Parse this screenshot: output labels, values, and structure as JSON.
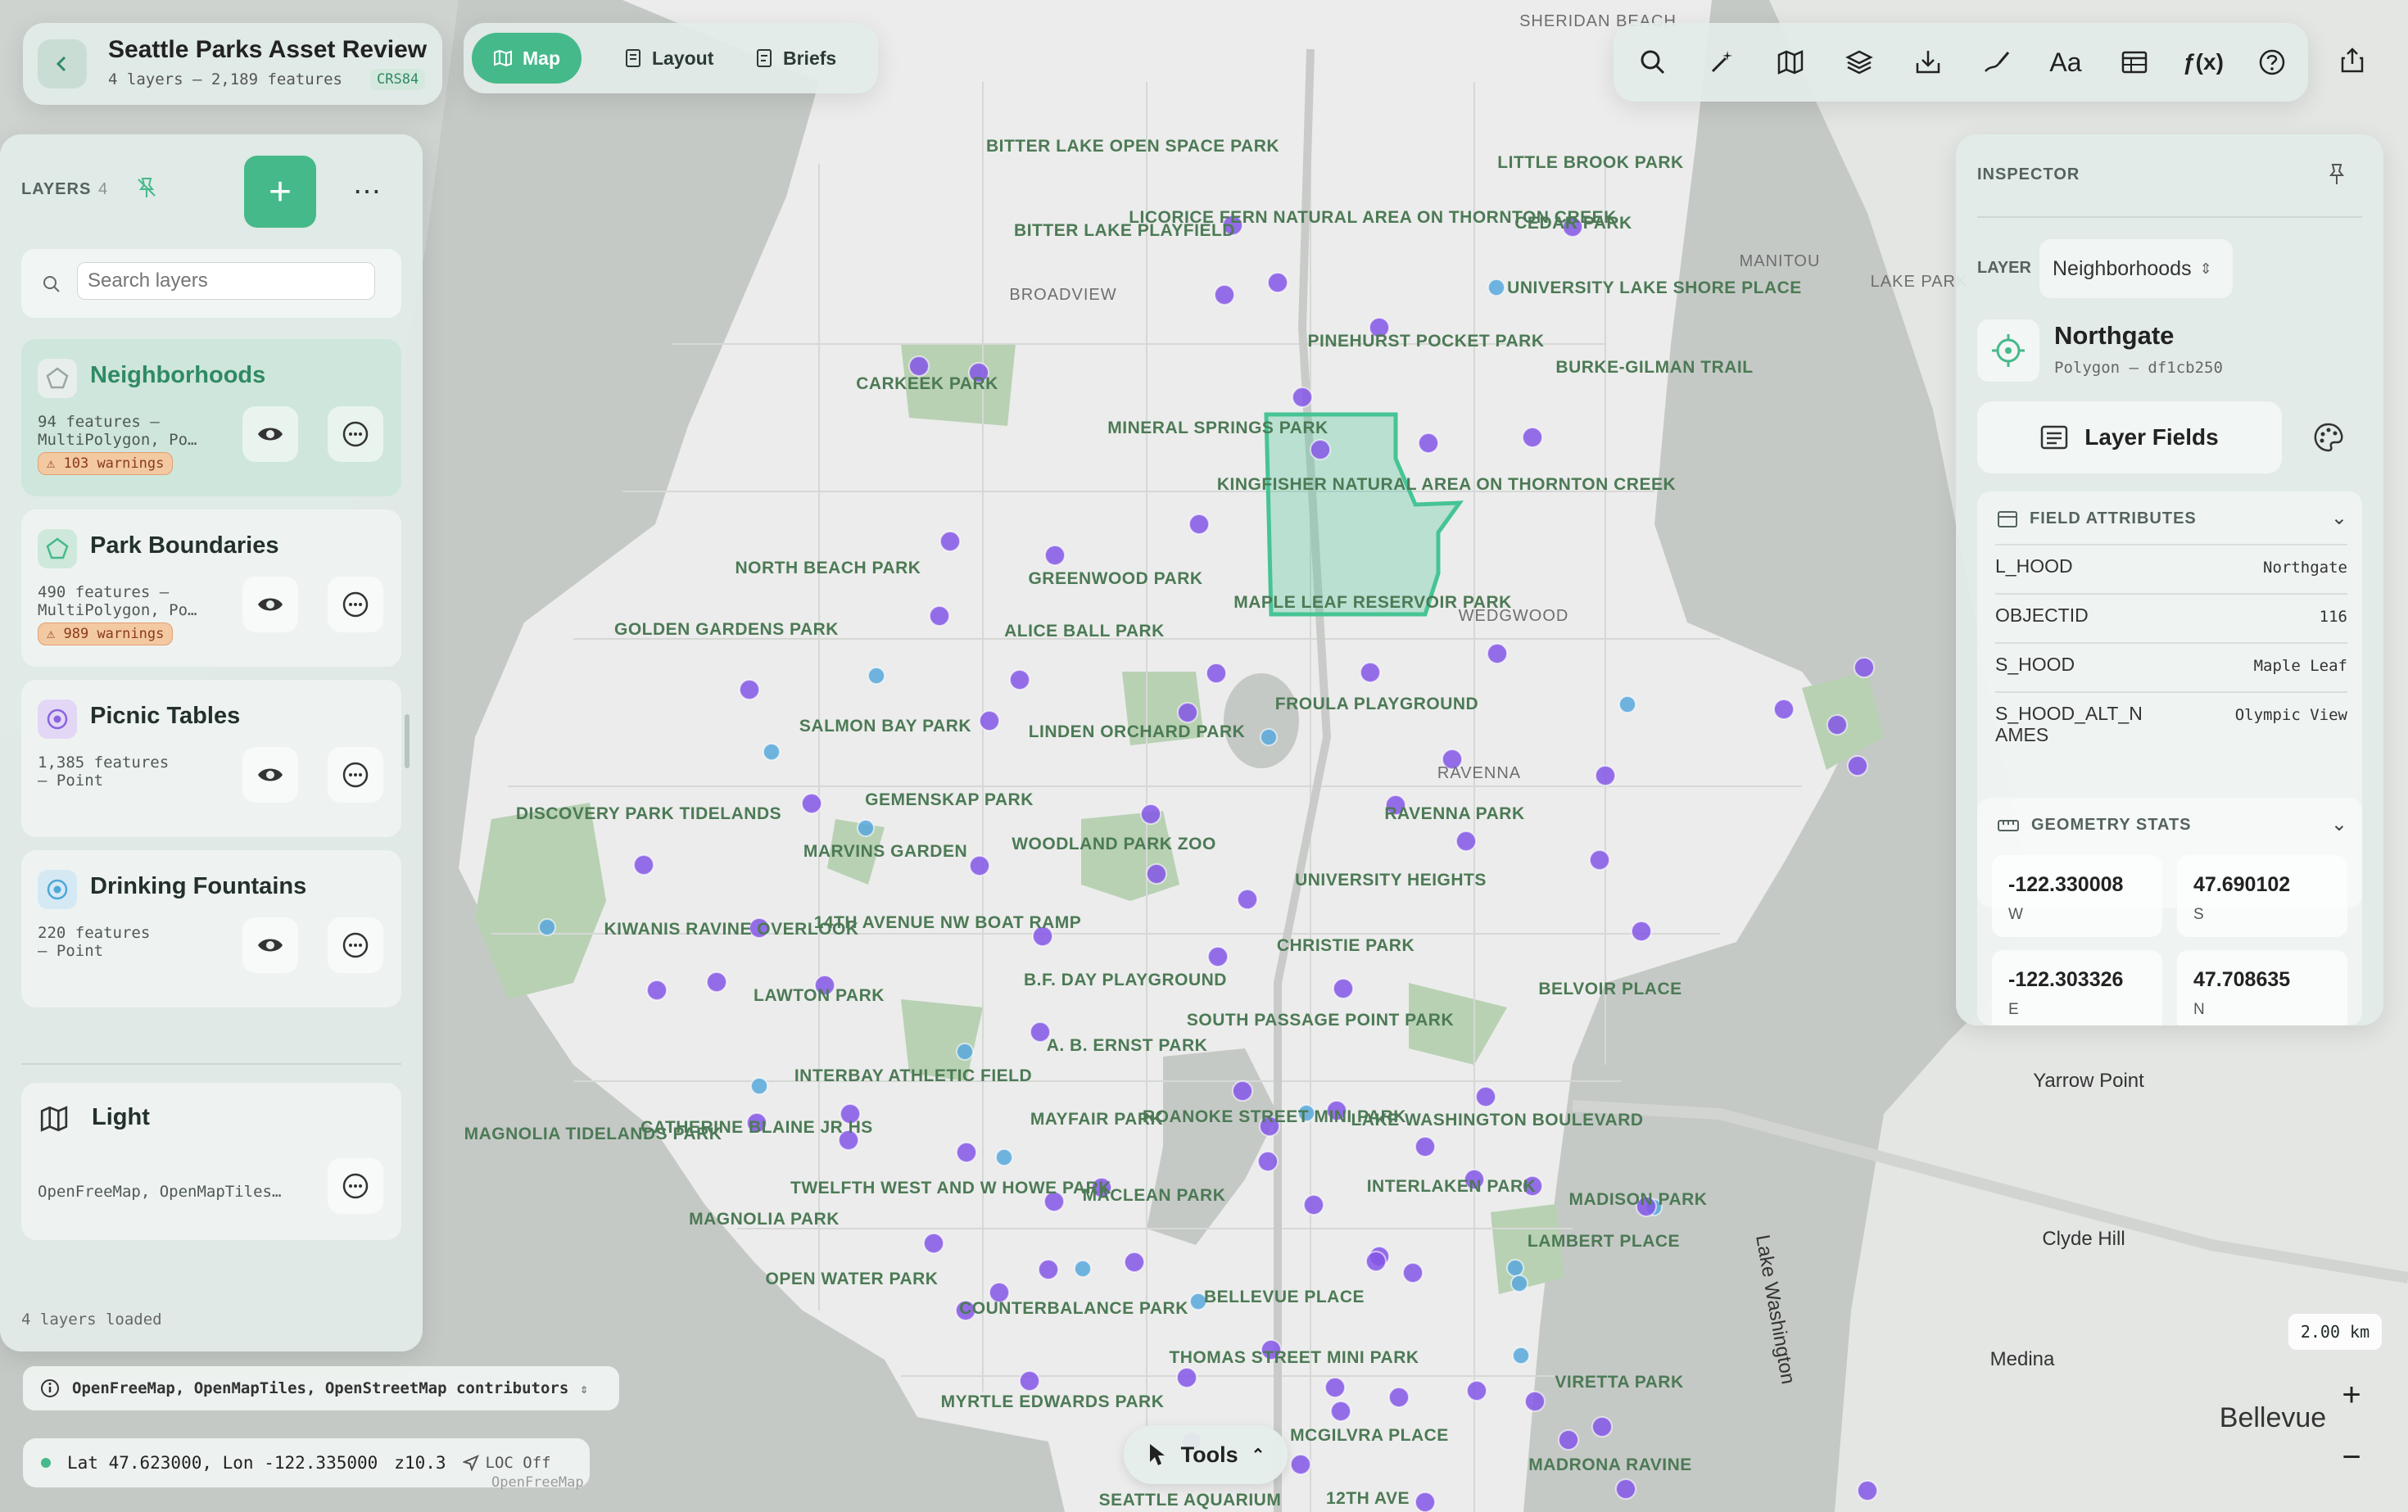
{
  "header": {
    "title": "Seattle Parks Asset Review",
    "subtitle": "4 layers – 2,189 features",
    "crs": "CRS84",
    "tabs": [
      {
        "label": "Map",
        "active": true
      },
      {
        "label": "Layout",
        "active": false
      },
      {
        "label": "Briefs",
        "active": false
      }
    ]
  },
  "toolbar": {
    "buttons": [
      "search-icon",
      "wand-icon",
      "map-icon",
      "layers-icon",
      "import-icon",
      "draw-icon",
      "text-icon",
      "table-icon",
      "function-icon",
      "help-icon"
    ],
    "text_label": "Aa",
    "fx_label": "ƒ(x)"
  },
  "layers_panel": {
    "title": "LAYERS",
    "count": "4",
    "search_placeholder": "Search layers",
    "layers": [
      {
        "name": "Neighborhoods",
        "meta": "94 features –\nMultiPolygon, Po…",
        "warnings": "103 warnings",
        "selected": true,
        "color": "#9aa6a1"
      },
      {
        "name": "Park Boundaries",
        "meta": "490 features –\nMultiPolygon, Po…",
        "warnings": "989 warnings",
        "selected": false,
        "color": "#46b98b"
      },
      {
        "name": "Picnic Tables",
        "meta": "1,385 features\n– Point",
        "warnings": "",
        "selected": false,
        "color": "#8a63e0"
      },
      {
        "name": "Drinking Fountains",
        "meta": "220 features\n– Point",
        "warnings": "",
        "selected": false,
        "color": "#4fa6d8"
      }
    ],
    "basemap": {
      "name": "Light",
      "meta": "OpenFreeMap, OpenMapTiles…"
    },
    "footer": "4 layers loaded"
  },
  "inspector": {
    "title": "INSPECTOR",
    "layer_label": "LAYER",
    "layer_value": "Neighborhoods",
    "feature_name": "Northgate",
    "feature_sub": "Polygon – df1cb250",
    "layer_fields_label": "Layer Fields",
    "field_attributes_title": "FIELD ATTRIBUTES",
    "attributes": [
      {
        "key": "L_HOOD",
        "value": "Northgate"
      },
      {
        "key": "OBJECTID",
        "value": "116"
      },
      {
        "key": "S_HOOD",
        "value": "Maple Leaf"
      },
      {
        "key": "S_HOOD_ALT_NAMES",
        "value": "Olympic View"
      }
    ],
    "geometry_stats_title": "GEOMETRY STATS",
    "geometry_stats": [
      {
        "value": "-122.330008",
        "label": "W"
      },
      {
        "value": "47.690102",
        "label": "S"
      },
      {
        "value": "-122.303326",
        "label": "E"
      },
      {
        "value": "47.708635",
        "label": "N"
      }
    ]
  },
  "map": {
    "attribution": "OpenFreeMap, OpenMapTiles, OpenStreetMap contributors",
    "lat_lon": "Lat 47.623000, Lon -122.335000",
    "zoom": "z10.3",
    "loc": "LOC Off",
    "scale": "2.00 km",
    "tools_label": "Tools",
    "zoom_in": "+",
    "zoom_out": "−",
    "watermark": "OpenFreeMap",
    "colors": {
      "park": "#a9c8a4",
      "water": "#b9bebb",
      "land": "#ececec",
      "point_purple": "#8456e6",
      "point_blue": "#58a8dc",
      "selection": "#46c494"
    },
    "park_labels": [
      "BITTER LAKE OPEN SPACE PARK",
      "BITTER LAKE PLAYFIELD",
      "LICORICE FERN NATURAL AREA ON THORNTON CREEK",
      "LITTLE BROOK PARK",
      "CEDAR PARK",
      "UNIVERSITY LAKE SHORE PLACE",
      "PINEHURST POCKET PARK",
      "BURKE-GILMAN TRAIL",
      "CARKEEK PARK",
      "MINERAL SPRINGS PARK",
      "KINGFISHER NATURAL AREA ON THORNTON CREEK",
      "NORTH BEACH PARK",
      "GREENWOOD PARK",
      "MAPLE LEAF RESERVOIR PARK",
      "GOLDEN GARDENS PARK",
      "ALICE BALL PARK",
      "FROULA PLAYGROUND",
      "SALMON BAY PARK",
      "LINDEN ORCHARD PARK",
      "DISCOVERY PARK TIDELANDS",
      "GEMENSKAP PARK",
      "RAVENNA PARK",
      "MARVINS GARDEN",
      "WOODLAND PARK ZOO",
      "UNIVERSITY HEIGHTS",
      "KIWANIS RAVINE OVERLOOK",
      "14TH AVENUE NW BOAT RAMP",
      "CHRISTIE PARK",
      "LAWTON PARK",
      "B.F. DAY PLAYGROUND",
      "BELVOIR PLACE",
      "SOUTH PASSAGE POINT PARK",
      "A. B. ERNST PARK",
      "INTERBAY ATHLETIC FIELD",
      "CATHERINE BLAINE JR HS",
      "MAGNOLIA TIDELANDS PARK",
      "MAYFAIR PARK",
      "ROANOKE STREET MINI PARK",
      "LAKE WASHINGTON BOULEVARD",
      "TWELFTH WEST AND W HOWE PARK",
      "MACLEAN PARK",
      "INTERLAKEN PARK",
      "MADISON PARK",
      "MAGNOLIA PARK",
      "LAMBERT PLACE",
      "OPEN WATER PARK",
      "COUNTERBALANCE PARK",
      "BELLEVUE PLACE",
      "THOMAS STREET MINI PARK",
      "VIRETTA PARK",
      "MYRTLE EDWARDS PARK",
      "MCGILVRA PLACE",
      "MADRONA RAVINE",
      "SEATTLE AQUARIUM",
      "12TH AVE"
    ],
    "place_labels": [
      "SHERIDAN BEACH",
      "BROADVIEW",
      "MANITOU",
      "LAKE PARK",
      "WEDGWOOD",
      "RAVENNA",
      "Yarrow Point",
      "Clyde Hill",
      "Medina",
      "Bellevue",
      "Lake Washington"
    ]
  }
}
